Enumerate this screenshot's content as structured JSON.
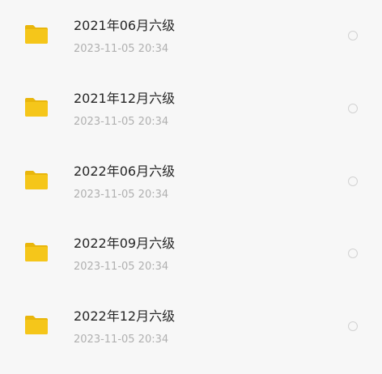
{
  "colors": {
    "folder": "#f5c61a",
    "folder_tab": "#e9b60c",
    "title_text": "#262626",
    "date_text": "#b0b0b0",
    "radio_border": "#d2d2d2",
    "background": "#f7f7f7"
  },
  "files": [
    {
      "icon": "folder-icon",
      "name": "2021年06月六级",
      "date": "2023-11-05  20:34",
      "selected": false
    },
    {
      "icon": "folder-icon",
      "name": "2021年12月六级",
      "date": "2023-11-05  20:34",
      "selected": false
    },
    {
      "icon": "folder-icon",
      "name": "2022年06月六级",
      "date": "2023-11-05  20:34",
      "selected": false
    },
    {
      "icon": "folder-icon",
      "name": "2022年09月六级",
      "date": "2023-11-05  20:34",
      "selected": false
    },
    {
      "icon": "folder-icon",
      "name": "2022年12月六级",
      "date": "2023-11-05  20:34",
      "selected": false
    }
  ]
}
